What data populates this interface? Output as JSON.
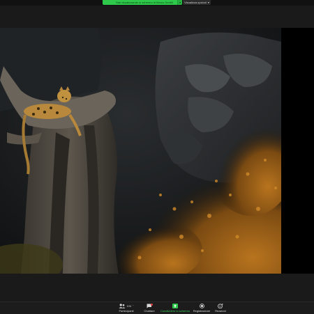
{
  "meeting": {
    "share_banner_text": "Stai visualizzando lo schermo di Marco Gentili",
    "view_options_label": "Visualizza opzioni"
  },
  "toolbar": {
    "participants_label": "Partecipanti",
    "participants_count": "104",
    "chat_label": "Chattare",
    "share_label": "Condividere lo schermo",
    "record_label": "Registrazione",
    "reactions_label": "Reazioni"
  },
  "colors": {
    "accent_green": "#2ec84a",
    "toolbar_bg": "#1c1c1c",
    "chat_badge": "#e04040"
  },
  "icons": {
    "participants": "people-icon",
    "chat": "chat-bubble-icon",
    "share": "share-screen-arrow-icon",
    "record": "record-icon",
    "reactions": "smiley-plus-icon"
  }
}
